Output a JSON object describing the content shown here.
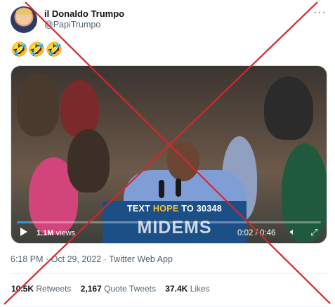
{
  "author": {
    "display_name": "il Donaldo Trumpo",
    "handle": "@PapiTrumpo"
  },
  "more_label": "···",
  "tweet_text": "🤣🤣🤣",
  "video": {
    "podium_line1_a": "TEXT ",
    "podium_line1_hl": "HOPE",
    "podium_line1_b": " TO 30348",
    "podium_logo": "MIDEMS",
    "views_count": "1.1M",
    "views_label": " views",
    "time_current": "0:02",
    "time_separator": " / ",
    "time_total": "0:46",
    "progress_fraction": 0.04
  },
  "timestamp": "6:18 PM · Oct 29, 2022 · Twitter Web App",
  "stats": [
    {
      "value": "10.5K",
      "label": "Retweets"
    },
    {
      "value": "2,167",
      "label": "Quote Tweets"
    },
    {
      "value": "37.4K",
      "label": "Likes"
    }
  ],
  "overlay_color": "#d7262b"
}
